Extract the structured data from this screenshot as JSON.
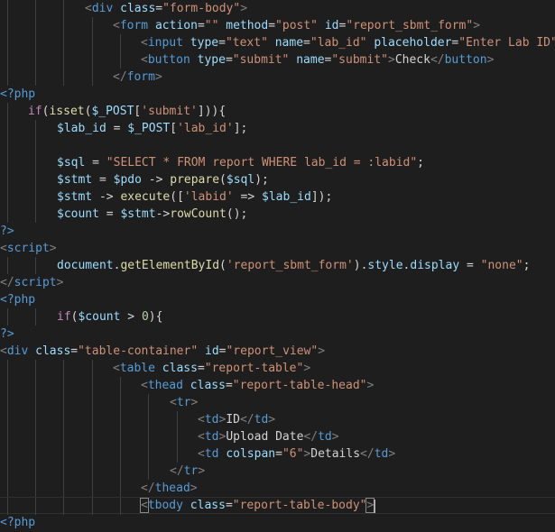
{
  "editor": {
    "language": "php",
    "theme_colors": {
      "background": "#1e1e1e",
      "tag": "#569cd6",
      "attribute": "#9cdcfe",
      "string": "#ce9178",
      "keyword": "#c586c0",
      "function": "#dcdcaa",
      "number": "#b5cea8",
      "punctuation": "#808080"
    },
    "lines": [
      {
        "indent": 12,
        "guides": [
          1,
          5,
          9
        ],
        "tokens": [
          {
            "c": "t-punct",
            "t": "<"
          },
          {
            "c": "t-tag",
            "t": "div"
          },
          {
            "c": "t-text",
            "t": " "
          },
          {
            "c": "t-attr",
            "t": "class"
          },
          {
            "c": "t-op",
            "t": "="
          },
          {
            "c": "t-str",
            "t": "\"form-body\""
          },
          {
            "c": "t-punct",
            "t": ">"
          }
        ]
      },
      {
        "indent": 16,
        "guides": [
          1,
          5,
          9,
          13
        ],
        "tokens": [
          {
            "c": "t-punct",
            "t": "<"
          },
          {
            "c": "t-tag",
            "t": "form"
          },
          {
            "c": "t-text",
            "t": " "
          },
          {
            "c": "t-attr",
            "t": "action"
          },
          {
            "c": "t-op",
            "t": "="
          },
          {
            "c": "t-str",
            "t": "\"\""
          },
          {
            "c": "t-text",
            "t": " "
          },
          {
            "c": "t-attr",
            "t": "method"
          },
          {
            "c": "t-op",
            "t": "="
          },
          {
            "c": "t-str",
            "t": "\"post\""
          },
          {
            "c": "t-text",
            "t": " "
          },
          {
            "c": "t-attr",
            "t": "id"
          },
          {
            "c": "t-op",
            "t": "="
          },
          {
            "c": "t-str",
            "t": "\"report_sbmt_form\""
          },
          {
            "c": "t-punct",
            "t": ">"
          }
        ]
      },
      {
        "indent": 20,
        "guides": [
          1,
          5,
          9,
          13,
          17
        ],
        "tokens": [
          {
            "c": "t-punct",
            "t": "<"
          },
          {
            "c": "t-tag",
            "t": "input"
          },
          {
            "c": "t-text",
            "t": " "
          },
          {
            "c": "t-attr",
            "t": "type"
          },
          {
            "c": "t-op",
            "t": "="
          },
          {
            "c": "t-str",
            "t": "\"text\""
          },
          {
            "c": "t-text",
            "t": " "
          },
          {
            "c": "t-attr",
            "t": "name"
          },
          {
            "c": "t-op",
            "t": "="
          },
          {
            "c": "t-str",
            "t": "\"lab_id\""
          },
          {
            "c": "t-text",
            "t": " "
          },
          {
            "c": "t-attr",
            "t": "placeholder"
          },
          {
            "c": "t-op",
            "t": "="
          },
          {
            "c": "t-str",
            "t": "\"Enter Lab ID\""
          },
          {
            "c": "t-punct",
            "t": ">"
          }
        ]
      },
      {
        "indent": 20,
        "guides": [
          1,
          5,
          9,
          13,
          17
        ],
        "tokens": [
          {
            "c": "t-punct",
            "t": "<"
          },
          {
            "c": "t-tag",
            "t": "button"
          },
          {
            "c": "t-text",
            "t": " "
          },
          {
            "c": "t-attr",
            "t": "type"
          },
          {
            "c": "t-op",
            "t": "="
          },
          {
            "c": "t-str",
            "t": "\"submit\""
          },
          {
            "c": "t-text",
            "t": " "
          },
          {
            "c": "t-attr",
            "t": "name"
          },
          {
            "c": "t-op",
            "t": "="
          },
          {
            "c": "t-str",
            "t": "\"submit\""
          },
          {
            "c": "t-punct",
            "t": ">"
          },
          {
            "c": "t-text",
            "t": "Check"
          },
          {
            "c": "t-punct",
            "t": "</"
          },
          {
            "c": "t-tag",
            "t": "button"
          },
          {
            "c": "t-punct",
            "t": ">"
          }
        ]
      },
      {
        "indent": 16,
        "guides": [
          1,
          5,
          9,
          13
        ],
        "tokens": [
          {
            "c": "t-punct",
            "t": "</"
          },
          {
            "c": "t-tag",
            "t": "form"
          },
          {
            "c": "t-punct",
            "t": ">"
          }
        ]
      },
      {
        "indent": 0,
        "guides": [],
        "tokens": [
          {
            "c": "t-tag",
            "t": "<?php"
          }
        ]
      },
      {
        "indent": 4,
        "guides": [
          1
        ],
        "tokens": [
          {
            "c": "t-kw",
            "t": "if"
          },
          {
            "c": "t-op",
            "t": "("
          },
          {
            "c": "t-fn",
            "t": "isset"
          },
          {
            "c": "t-op",
            "t": "("
          },
          {
            "c": "t-var",
            "t": "$_POST"
          },
          {
            "c": "t-op",
            "t": "["
          },
          {
            "c": "t-str",
            "t": "'submit'"
          },
          {
            "c": "t-op",
            "t": "])){"
          }
        ]
      },
      {
        "indent": 8,
        "guides": [
          1,
          5
        ],
        "tokens": [
          {
            "c": "t-var",
            "t": "$lab_id"
          },
          {
            "c": "t-op",
            "t": " = "
          },
          {
            "c": "t-var",
            "t": "$_POST"
          },
          {
            "c": "t-op",
            "t": "["
          },
          {
            "c": "t-str",
            "t": "'lab_id'"
          },
          {
            "c": "t-op",
            "t": "];"
          }
        ]
      },
      {
        "indent": 0,
        "guides": [
          1,
          5
        ],
        "tokens": []
      },
      {
        "indent": 8,
        "guides": [
          1,
          5
        ],
        "tokens": [
          {
            "c": "t-var",
            "t": "$sql"
          },
          {
            "c": "t-op",
            "t": " = "
          },
          {
            "c": "t-str",
            "t": "\"SELECT * FROM report WHERE lab_id = :labid\""
          },
          {
            "c": "t-op",
            "t": ";"
          }
        ]
      },
      {
        "indent": 8,
        "guides": [
          1,
          5
        ],
        "tokens": [
          {
            "c": "t-var",
            "t": "$stmt"
          },
          {
            "c": "t-op",
            "t": " = "
          },
          {
            "c": "t-var",
            "t": "$pdo"
          },
          {
            "c": "t-op",
            "t": " -> "
          },
          {
            "c": "t-fn",
            "t": "prepare"
          },
          {
            "c": "t-op",
            "t": "("
          },
          {
            "c": "t-var",
            "t": "$sql"
          },
          {
            "c": "t-op",
            "t": ");"
          }
        ]
      },
      {
        "indent": 8,
        "guides": [
          1,
          5
        ],
        "tokens": [
          {
            "c": "t-var",
            "t": "$stmt"
          },
          {
            "c": "t-op",
            "t": " -> "
          },
          {
            "c": "t-fn",
            "t": "execute"
          },
          {
            "c": "t-op",
            "t": "(["
          },
          {
            "c": "t-str",
            "t": "'labid'"
          },
          {
            "c": "t-op",
            "t": " => "
          },
          {
            "c": "t-var",
            "t": "$lab_id"
          },
          {
            "c": "t-op",
            "t": "]);"
          }
        ]
      },
      {
        "indent": 8,
        "guides": [
          1,
          5
        ],
        "tokens": [
          {
            "c": "t-var",
            "t": "$count"
          },
          {
            "c": "t-op",
            "t": " = "
          },
          {
            "c": "t-var",
            "t": "$stmt"
          },
          {
            "c": "t-op",
            "t": "->"
          },
          {
            "c": "t-fn",
            "t": "rowCount"
          },
          {
            "c": "t-op",
            "t": "();"
          }
        ]
      },
      {
        "indent": 0,
        "guides": [],
        "tokens": [
          {
            "c": "t-tag",
            "t": "?>"
          }
        ]
      },
      {
        "indent": 0,
        "guides": [],
        "tokens": [
          {
            "c": "t-punct",
            "t": "<"
          },
          {
            "c": "t-tag",
            "t": "script"
          },
          {
            "c": "t-punct",
            "t": ">"
          }
        ]
      },
      {
        "indent": 8,
        "guides": [
          1,
          5
        ],
        "tokens": [
          {
            "c": "t-var",
            "t": "document"
          },
          {
            "c": "t-op",
            "t": "."
          },
          {
            "c": "t-fn",
            "t": "getElementById"
          },
          {
            "c": "t-op",
            "t": "("
          },
          {
            "c": "t-str",
            "t": "'report_sbmt_form'"
          },
          {
            "c": "t-op",
            "t": ")."
          },
          {
            "c": "t-var",
            "t": "style"
          },
          {
            "c": "t-op",
            "t": "."
          },
          {
            "c": "t-var",
            "t": "display"
          },
          {
            "c": "t-op",
            "t": " = "
          },
          {
            "c": "t-str",
            "t": "\"none\""
          },
          {
            "c": "t-op",
            "t": ";"
          }
        ]
      },
      {
        "indent": 0,
        "guides": [],
        "tokens": [
          {
            "c": "t-punct",
            "t": "</"
          },
          {
            "c": "t-tag",
            "t": "script"
          },
          {
            "c": "t-punct",
            "t": ">"
          }
        ]
      },
      {
        "indent": 0,
        "guides": [],
        "tokens": [
          {
            "c": "t-tag",
            "t": "<?php"
          }
        ]
      },
      {
        "indent": 8,
        "guides": [
          1,
          5
        ],
        "tokens": [
          {
            "c": "t-kw",
            "t": "if"
          },
          {
            "c": "t-op",
            "t": "("
          },
          {
            "c": "t-var",
            "t": "$count"
          },
          {
            "c": "t-op",
            "t": " > "
          },
          {
            "c": "t-num",
            "t": "0"
          },
          {
            "c": "t-op",
            "t": "){"
          }
        ]
      },
      {
        "indent": 0,
        "guides": [],
        "tokens": [
          {
            "c": "t-tag",
            "t": "?>"
          }
        ]
      },
      {
        "indent": 0,
        "guides": [],
        "tokens": [
          {
            "c": "t-punct",
            "t": "<"
          },
          {
            "c": "t-tag",
            "t": "div"
          },
          {
            "c": "t-text",
            "t": " "
          },
          {
            "c": "t-attr",
            "t": "class"
          },
          {
            "c": "t-op",
            "t": "="
          },
          {
            "c": "t-str",
            "t": "\"table-container\""
          },
          {
            "c": "t-text",
            "t": " "
          },
          {
            "c": "t-attr",
            "t": "id"
          },
          {
            "c": "t-op",
            "t": "="
          },
          {
            "c": "t-str",
            "t": "\"report_view\""
          },
          {
            "c": "t-punct",
            "t": ">"
          }
        ]
      },
      {
        "indent": 16,
        "guides": [
          1,
          5,
          9,
          13
        ],
        "tokens": [
          {
            "c": "t-punct",
            "t": "<"
          },
          {
            "c": "t-tag",
            "t": "table"
          },
          {
            "c": "t-text",
            "t": " "
          },
          {
            "c": "t-attr",
            "t": "class"
          },
          {
            "c": "t-op",
            "t": "="
          },
          {
            "c": "t-str",
            "t": "\"report-table\""
          },
          {
            "c": "t-punct",
            "t": ">"
          }
        ]
      },
      {
        "indent": 20,
        "guides": [
          1,
          5,
          9,
          13,
          17
        ],
        "tokens": [
          {
            "c": "t-punct",
            "t": "<"
          },
          {
            "c": "t-tag",
            "t": "thead"
          },
          {
            "c": "t-text",
            "t": " "
          },
          {
            "c": "t-attr",
            "t": "class"
          },
          {
            "c": "t-op",
            "t": "="
          },
          {
            "c": "t-str",
            "t": "\"report-table-head\""
          },
          {
            "c": "t-punct",
            "t": ">"
          }
        ]
      },
      {
        "indent": 24,
        "guides": [
          1,
          5,
          9,
          13,
          17,
          21
        ],
        "tokens": [
          {
            "c": "t-punct",
            "t": "<"
          },
          {
            "c": "t-tag",
            "t": "tr"
          },
          {
            "c": "t-punct",
            "t": ">"
          }
        ]
      },
      {
        "indent": 28,
        "guides": [
          1,
          5,
          9,
          13,
          17,
          21,
          25
        ],
        "tokens": [
          {
            "c": "t-punct",
            "t": "<"
          },
          {
            "c": "t-tag",
            "t": "td"
          },
          {
            "c": "t-punct",
            "t": ">"
          },
          {
            "c": "t-text",
            "t": "ID"
          },
          {
            "c": "t-punct",
            "t": "</"
          },
          {
            "c": "t-tag",
            "t": "td"
          },
          {
            "c": "t-punct",
            "t": ">"
          }
        ]
      },
      {
        "indent": 28,
        "guides": [
          1,
          5,
          9,
          13,
          17,
          21,
          25
        ],
        "tokens": [
          {
            "c": "t-punct",
            "t": "<"
          },
          {
            "c": "t-tag",
            "t": "td"
          },
          {
            "c": "t-punct",
            "t": ">"
          },
          {
            "c": "t-text",
            "t": "Upload Date"
          },
          {
            "c": "t-punct",
            "t": "</"
          },
          {
            "c": "t-tag",
            "t": "td"
          },
          {
            "c": "t-punct",
            "t": ">"
          }
        ]
      },
      {
        "indent": 28,
        "guides": [
          1,
          5,
          9,
          13,
          17,
          21,
          25
        ],
        "tokens": [
          {
            "c": "t-punct",
            "t": "<"
          },
          {
            "c": "t-tag",
            "t": "td"
          },
          {
            "c": "t-text",
            "t": " "
          },
          {
            "c": "t-attr",
            "t": "colspan"
          },
          {
            "c": "t-op",
            "t": "="
          },
          {
            "c": "t-str",
            "t": "\"6\""
          },
          {
            "c": "t-punct",
            "t": ">"
          },
          {
            "c": "t-text",
            "t": "Details"
          },
          {
            "c": "t-punct",
            "t": "</"
          },
          {
            "c": "t-tag",
            "t": "td"
          },
          {
            "c": "t-punct",
            "t": ">"
          }
        ]
      },
      {
        "indent": 24,
        "guides": [
          1,
          5,
          9,
          13,
          17,
          21
        ],
        "tokens": [
          {
            "c": "t-punct",
            "t": "</"
          },
          {
            "c": "t-tag",
            "t": "tr"
          },
          {
            "c": "t-punct",
            "t": ">"
          }
        ]
      },
      {
        "indent": 20,
        "guides": [
          1,
          5,
          9,
          13,
          17
        ],
        "tokens": [
          {
            "c": "t-punct",
            "t": "</"
          },
          {
            "c": "t-tag",
            "t": "thead"
          },
          {
            "c": "t-punct",
            "t": ">"
          }
        ]
      },
      {
        "indent": 20,
        "guides": [
          1,
          5,
          9,
          13,
          17
        ],
        "cursor": true,
        "tokens": [
          {
            "c": "t-punct bracket-match",
            "t": "<"
          },
          {
            "c": "t-tag",
            "t": "tbody"
          },
          {
            "c": "t-text",
            "t": " "
          },
          {
            "c": "t-attr",
            "t": "class"
          },
          {
            "c": "t-op",
            "t": "="
          },
          {
            "c": "t-str",
            "t": "\"report-table-body\""
          },
          {
            "c": "t-punct bracket-match",
            "t": ">"
          }
        ]
      },
      {
        "indent": 0,
        "guides": [],
        "tokens": [
          {
            "c": "t-tag",
            "t": "<?php"
          }
        ]
      }
    ]
  }
}
